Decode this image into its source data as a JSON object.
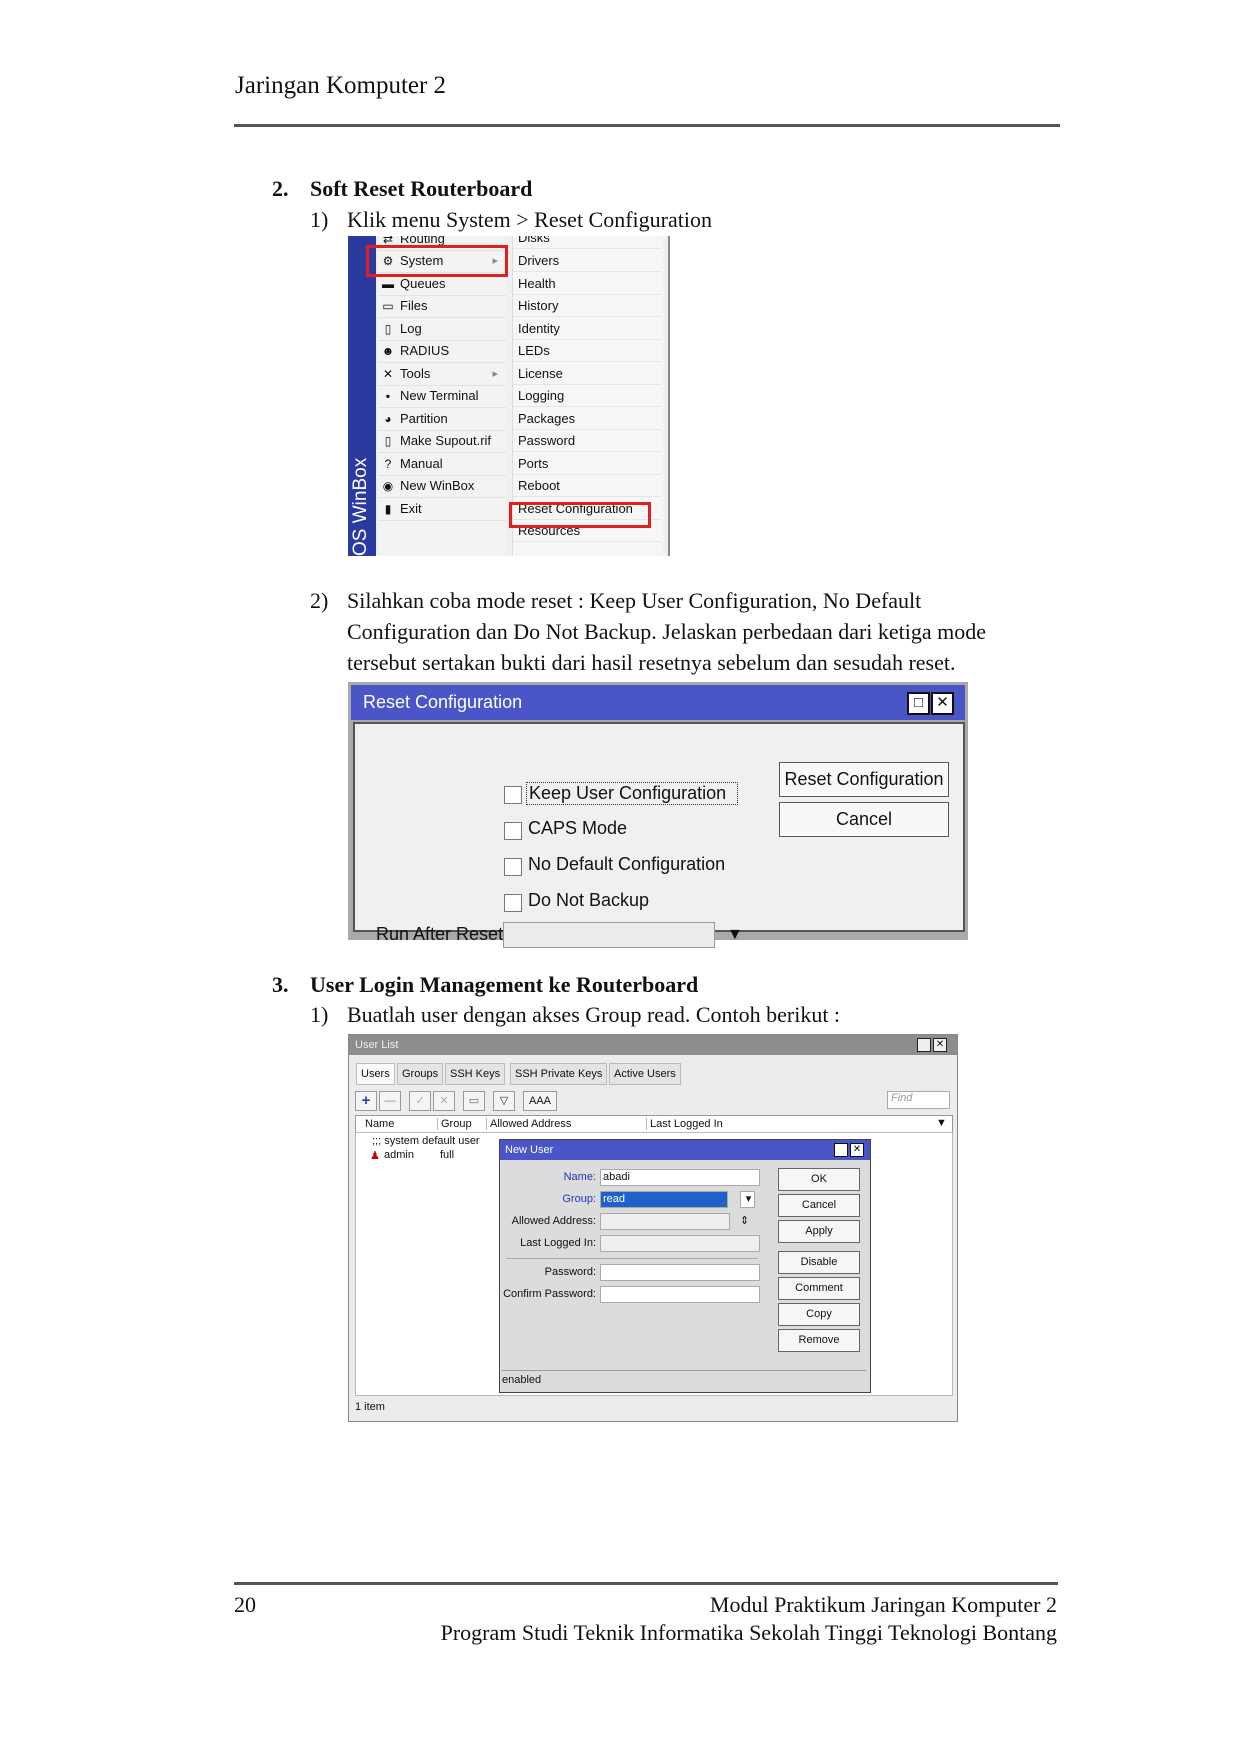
{
  "header": {
    "title": "Jaringan Komputer 2"
  },
  "section2": {
    "number": "2.",
    "title": "Soft Reset Routerboard",
    "step1_num": "1)",
    "step1_text": "Klik menu System > Reset Configuration",
    "step2_num": "2)",
    "step2_line1": "Silahkan coba mode reset : Keep User Configuration, No Default",
    "step2_line2": "Configuration dan Do Not Backup. Jelaskan perbedaan dari ketiga mode",
    "step2_line3": "tersebut sertakan bukti dari hasil resetnya sebelum dan sesudah reset."
  },
  "winbox_menu": {
    "sidebar_label": "OS WinBox",
    "main_items": [
      "Routing",
      "System",
      "Queues",
      "Files",
      "Log",
      "RADIUS",
      "Tools",
      "New Terminal",
      "Partition",
      "Make Supout.rif",
      "Manual",
      "New WinBox",
      "Exit"
    ],
    "submenu_items": [
      "Disks",
      "Drivers",
      "Health",
      "History",
      "Identity",
      "LEDs",
      "License",
      "Logging",
      "Packages",
      "Password",
      "Ports",
      "Reboot",
      "Reset Configuration",
      "Resources"
    ]
  },
  "reset_dialog": {
    "title": "Reset Configuration",
    "keep_user": "Keep User Configuration",
    "caps_mode": "CAPS Mode",
    "no_default": "No Default Configuration",
    "no_backup": "Do Not Backup",
    "run_after_label": "Run After Reset:",
    "reset_button": "Reset Configuration",
    "cancel_button": "Cancel",
    "maximize": "□",
    "close": "✕"
  },
  "section3": {
    "number": "3.",
    "title": "User Login Management ke Routerboard",
    "step1_num": "1)",
    "step1_text": "Buatlah user dengan akses Group read. Contoh berikut :"
  },
  "user_list": {
    "title": "User List",
    "tabs": [
      "Users",
      "Groups",
      "SSH Keys",
      "SSH Private Keys",
      "Active Users"
    ],
    "aaa_button": "AAA",
    "find_placeholder": "Find",
    "columns": [
      "Name",
      "Group",
      "Allowed Address",
      "Last Logged In"
    ],
    "comment_row": ";;; system default user",
    "row_name": "admin",
    "row_group": "full",
    "status": "1 item"
  },
  "new_user": {
    "title": "New User",
    "name_label": "Name:",
    "name_value": "abadi",
    "group_label": "Group:",
    "group_value": "read",
    "allowed_label": "Allowed Address:",
    "last_label": "Last Logged In:",
    "password_label": "Password:",
    "confirm_label": "Confirm Password:",
    "buttons": [
      "OK",
      "Cancel",
      "Apply",
      "Disable",
      "Comment",
      "Copy",
      "Remove"
    ],
    "status": "enabled"
  },
  "footer": {
    "page_number": "20",
    "line1": "Modul Praktikum Jaringan Komputer 2",
    "line2": "Program Studi Teknik Informatika Sekolah Tinggi Teknologi Bontang"
  }
}
